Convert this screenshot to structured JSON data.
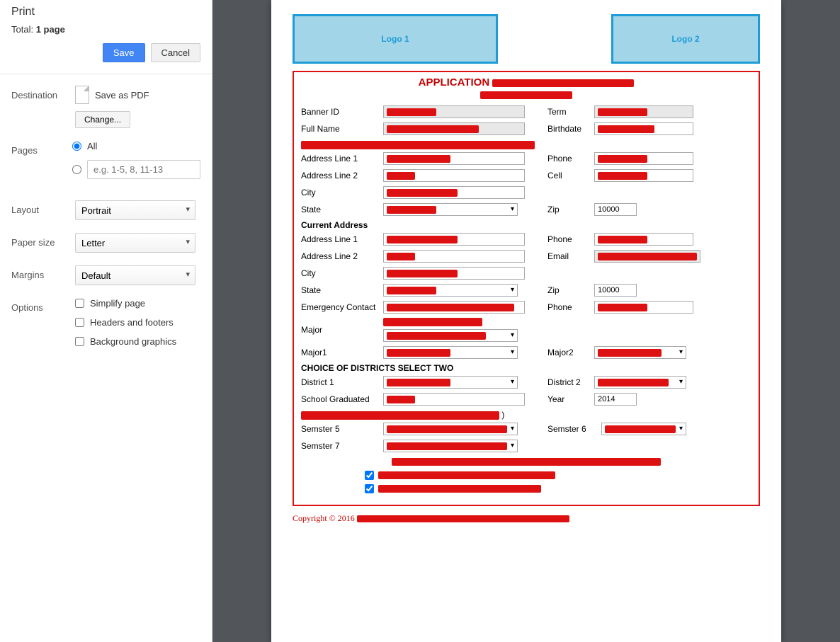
{
  "sidebar": {
    "title": "Print",
    "total_prefix": "Total: ",
    "total_value": "1 page",
    "save_btn": "Save",
    "cancel_btn": "Cancel",
    "destination_label": "Destination",
    "destination_value": "Save as PDF",
    "change_btn": "Change...",
    "pages_label": "Pages",
    "pages_all": "All",
    "pages_placeholder": "e.g. 1-5, 8, 11-13",
    "layout_label": "Layout",
    "layout_value": "Portrait",
    "papersize_label": "Paper size",
    "papersize_value": "Letter",
    "margins_label": "Margins",
    "margins_value": "Default",
    "options_label": "Options",
    "opt_simplify": "Simplify page",
    "opt_headers": "Headers and footers",
    "opt_background": "Background graphics"
  },
  "page": {
    "logo1": "Logo 1",
    "logo2": "Logo 2",
    "app_title": "APPLICATION",
    "labels": {
      "banner_id": "Banner ID",
      "term": "Term",
      "full_name": "Full Name",
      "birthdate": "Birthdate",
      "addr1": "Address Line 1",
      "addr2": "Address Line 2",
      "city": "City",
      "state": "State",
      "phone": "Phone",
      "cell": "Cell",
      "zip": "Zip",
      "current_address": "Current Address",
      "email": "Email",
      "emergency": "Emergency Contact",
      "major": "Major",
      "major1": "Major1",
      "major2": "Major2",
      "choice_districts": "CHOICE OF DISTRICTS SELECT TWO",
      "district1": "District 1",
      "district2": "District 2",
      "school_grad": "School Graduated",
      "year": "Year",
      "sem5": "Semster 5",
      "sem6": "Semster 6",
      "sem7": "Semster 7"
    },
    "values": {
      "zip1": "10000",
      "zip2": "10000",
      "year": "2014"
    },
    "copyright": "Copyright © 2016"
  }
}
